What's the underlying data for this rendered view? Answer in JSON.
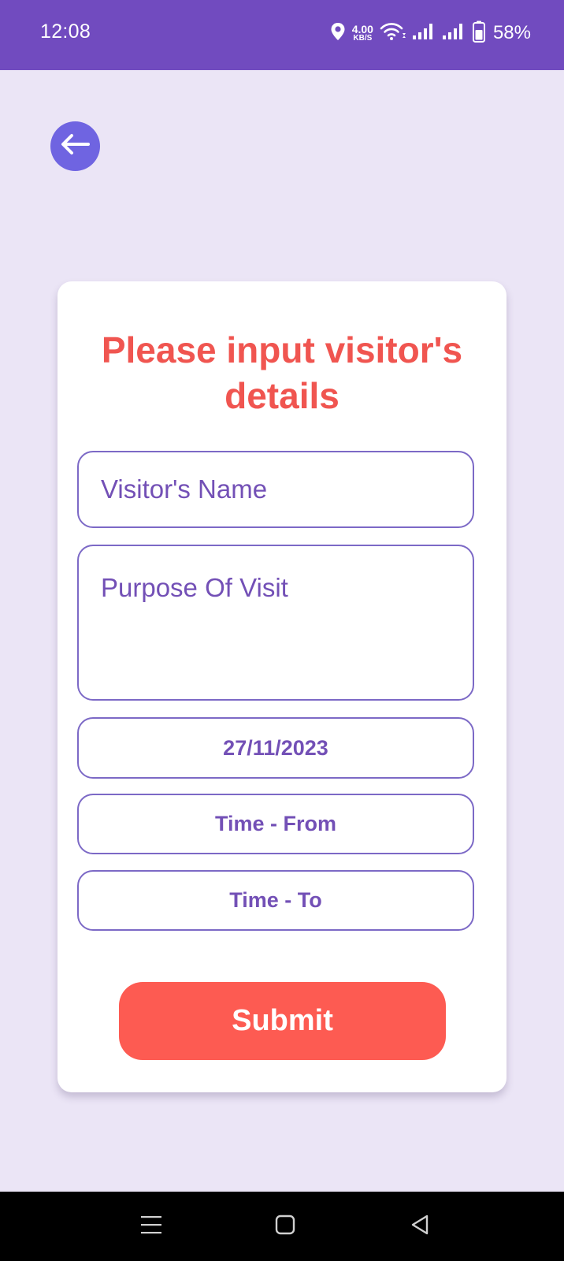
{
  "status_bar": {
    "time": "12:08",
    "speed_value": "4.00",
    "speed_unit": "KB/S",
    "battery_percent": "58%",
    "icons": [
      "location-icon",
      "wifi-icon",
      "signal-icon",
      "signal-icon",
      "battery-icon"
    ]
  },
  "header": {
    "back_icon": "arrow-left-icon"
  },
  "form": {
    "title": "Please input visitor's details",
    "visitor_name_placeholder": "Visitor's Name",
    "purpose_placeholder": "Purpose Of Visit",
    "date_value": "27/11/2023",
    "time_from_label": "Time - From",
    "time_to_label": "Time - To",
    "submit_label": "Submit"
  },
  "nav_bar": {
    "icons": [
      "menu-icon",
      "home-icon",
      "back-icon"
    ]
  },
  "colors": {
    "status_bar": "#714bbf",
    "background": "#ebe5f6",
    "accent_purple": "#7350b6",
    "back_button": "#6f64e1",
    "title_red": "#f05550",
    "submit": "#fd5b52"
  }
}
